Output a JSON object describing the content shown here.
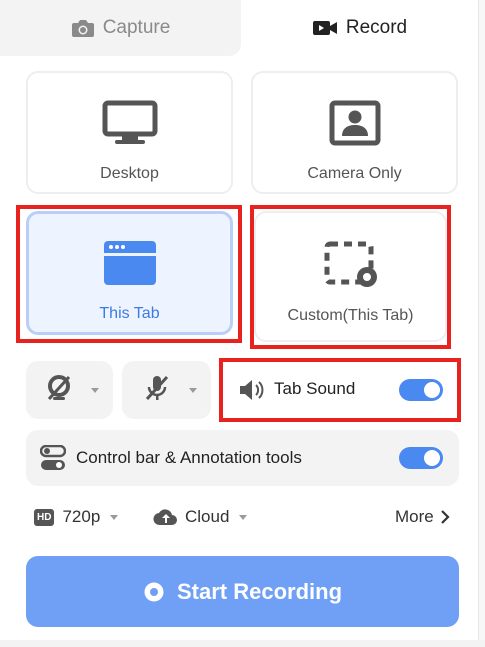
{
  "tabs": {
    "capture_label": "Capture",
    "record_label": "Record",
    "active": "Record"
  },
  "modes": [
    {
      "id": "desktop",
      "label": "Desktop",
      "icon": "monitor-icon"
    },
    {
      "id": "camera",
      "label": "Camera Only",
      "icon": "camera-user-icon"
    },
    {
      "id": "this-tab",
      "label": "This Tab",
      "icon": "browser-tab-icon",
      "selected": true
    },
    {
      "id": "custom",
      "label": "Custom(This Tab)",
      "icon": "custom-area-icon"
    }
  ],
  "audio": {
    "camera_icon": "camera-off-icon",
    "mic_icon": "microphone-off-icon",
    "tab_sound_label": "Tab Sound",
    "tab_sound_on": true
  },
  "control_bar": {
    "label": "Control bar & Annotation tools",
    "on": true
  },
  "options": {
    "resolution": "720p",
    "resolution_badge": "HD",
    "storage": "Cloud",
    "more_label": "More"
  },
  "start_button": {
    "label": "Start Recording"
  },
  "colors": {
    "accent": "#4a8af0",
    "highlight": "#e8231f",
    "selected_bg": "#eef4ff",
    "start_bg": "#6fa0f5"
  }
}
